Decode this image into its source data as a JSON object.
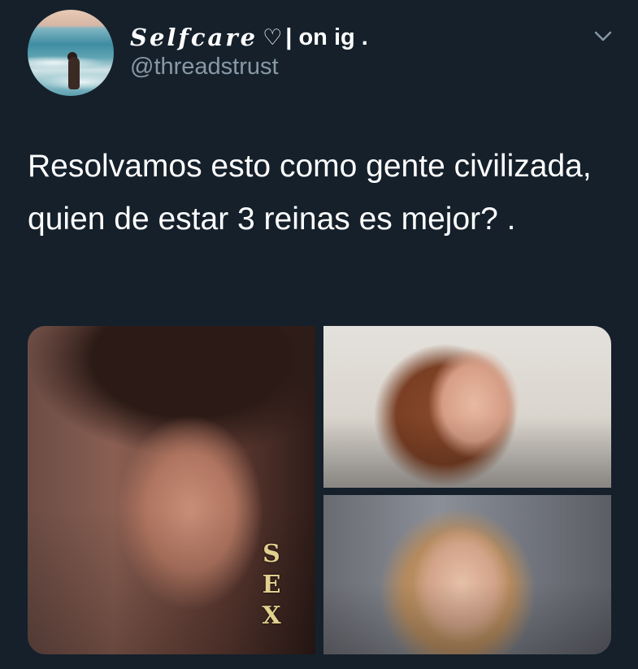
{
  "author": {
    "display_name_script": "Selfcare",
    "display_name_heart": "♡",
    "display_name_rest": "| on ig .",
    "handle": "@threadstrust"
  },
  "icons": {
    "more": "chevron-down-icon"
  },
  "tweet": {
    "text": "Resolvamos esto como gente civilizada, quien de estar 3 reinas es mejor? .",
    "earring_text": "SEX"
  },
  "colors": {
    "background": "#15202b",
    "text_primary": "#ffffff",
    "text_secondary": "#8899a6"
  }
}
